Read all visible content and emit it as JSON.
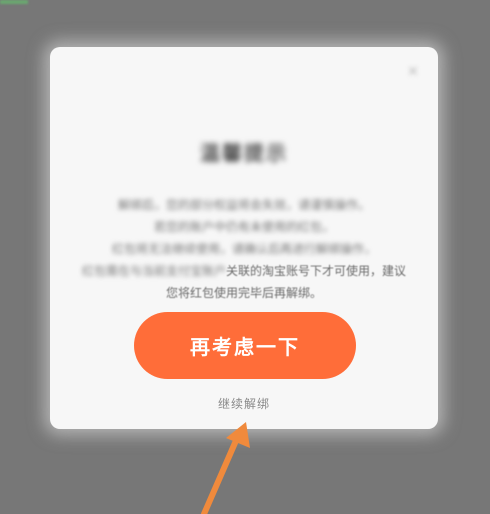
{
  "dialog": {
    "title": "温馨提示",
    "body_blurred_lines": [
      "解绑后，您的部分权益将会失效，请谨慎操作。",
      "若您的账户中仍有未使用的红包，",
      "红包将无法继续使用，请确认后再进行解绑操作，"
    ],
    "body_line_partial": "红包需在与当前支付宝账户",
    "body_line_visible_a": "关联的淘宝账号下才可使用，建议",
    "body_line_visible_b": "您将红包使用完毕后再解绑。",
    "primary_button": "再考虑一下",
    "secondary_link": "继续解绑"
  },
  "colors": {
    "overlay": "#777777",
    "dialog_bg": "#f7f7f7",
    "accent": "#ff6d39",
    "arrow": "#f08a3c"
  },
  "icons": {
    "close": "close-icon",
    "pointer": "pointer-arrow"
  }
}
